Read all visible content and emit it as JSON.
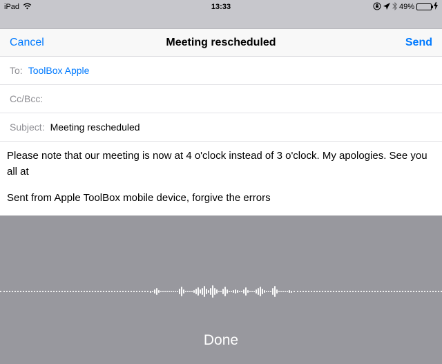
{
  "statusbar": {
    "device": "iPad",
    "time": "13:33",
    "battery_percent": "49%"
  },
  "navbar": {
    "cancel": "Cancel",
    "title": "Meeting rescheduled",
    "send": "Send"
  },
  "fields": {
    "to_label": "To:",
    "to_value": "ToolBox Apple",
    "ccbcc_label": "Cc/Bcc:",
    "subject_label": "Subject:",
    "subject_value": "Meeting rescheduled"
  },
  "body": {
    "text": "Please note that our meeting is now at 4 o'clock instead of 3 o'clock. My apologies. See you all at",
    "signature": "Sent from Apple ToolBox mobile device, forgive the errors"
  },
  "dictation": {
    "done": "Done"
  }
}
